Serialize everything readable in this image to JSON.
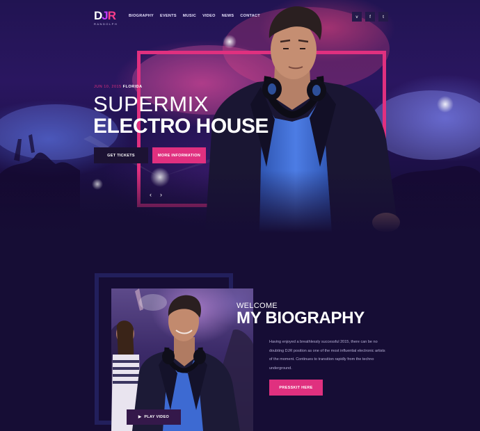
{
  "header": {
    "logo_letters": [
      "D",
      "J",
      "R"
    ],
    "logo_subtitle": "RANDOLPH",
    "nav": [
      "BIOGRAPHY",
      "EVENTS",
      "MUSIC",
      "VIDEO",
      "NEWS",
      "CONTACT"
    ],
    "social": [
      {
        "icon": "vimeo-icon",
        "glyph": "v"
      },
      {
        "icon": "facebook-icon",
        "glyph": "f"
      },
      {
        "icon": "twitter-icon",
        "glyph": "t"
      }
    ]
  },
  "hero": {
    "date": "JUN 10, 2015",
    "place": "FLORIDA",
    "title_line1": "SUPERMIX",
    "title_line2": "ELECTRO HOUSE",
    "buttons": {
      "tickets": "GET TICKETS",
      "info": "MORE INFORMATION"
    },
    "arrows": {
      "prev": "‹",
      "next": "›"
    }
  },
  "bio": {
    "welcome": "WELCOME",
    "title": "MY BIOGRAPHY",
    "text": "Having enjoyed a breathlessly successful 2015, there can be no doubting DJR position as one of the most influential electronic artists of the moment. Continues to transition rapidly from the techno underground.",
    "presskit": "PRESSKIT HERE",
    "play_video": "PLAY VIDEO"
  },
  "colors": {
    "accent": "#e0307f",
    "background": "#160d35",
    "button_dark": "#1c1233"
  }
}
